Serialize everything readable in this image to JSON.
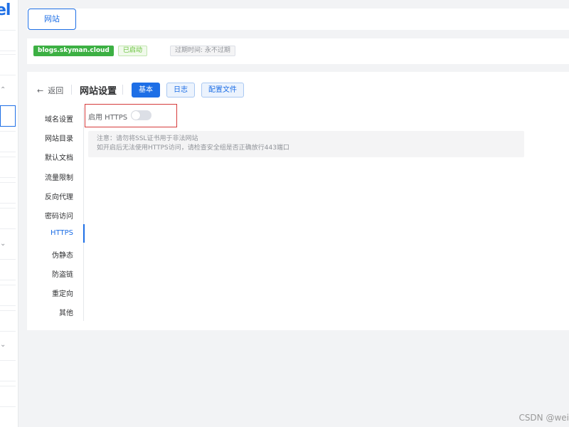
{
  "sidebar": {
    "logo_text": "el",
    "rows": 14,
    "chevrons": [
      "up",
      "down",
      "down"
    ]
  },
  "tabs": [
    {
      "label": "网站"
    }
  ],
  "site": {
    "domain": "blogs.skyman.cloud",
    "status": "已启动",
    "expiry": "过期时间: 永不过期"
  },
  "header": {
    "back_label": "返回",
    "title": "网站设置",
    "buttons": [
      "基本",
      "日志",
      "配置文件"
    ],
    "active_button": "基本"
  },
  "menu": {
    "items": [
      "域名设置",
      "网站目录",
      "默认文档",
      "流量限制",
      "反向代理",
      "密码访问",
      "HTTPS",
      "伪静态",
      "防盗链",
      "重定向",
      "其他"
    ],
    "active": "HTTPS"
  },
  "https": {
    "label": "启用 HTTPS",
    "enabled": false
  },
  "notice": {
    "line1": "注意：请勿将SSL证书用于非法网站",
    "line2": "如开启后无法使用HTTPS访问，请检查安全组是否正确放行443端口"
  },
  "watermark": "CSDN @wei",
  "colors": {
    "accent": "#1e6fe6",
    "success": "#3cb043",
    "highlight_border": "#d63b3b"
  }
}
